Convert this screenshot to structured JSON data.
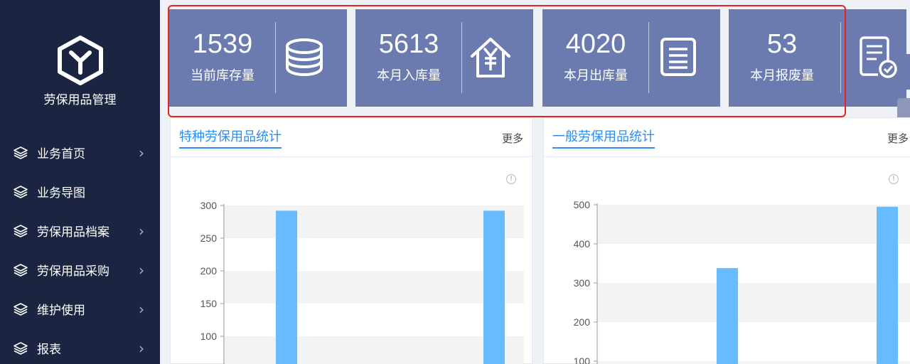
{
  "app": {
    "title": "劳保用品管理"
  },
  "sidebar": {
    "items": [
      {
        "label": "业务首页",
        "icon": "layers-icon",
        "has_children": true
      },
      {
        "label": "业务导图",
        "icon": "layers-icon",
        "has_children": false
      },
      {
        "label": "劳保用品档案",
        "icon": "layers-icon",
        "has_children": true
      },
      {
        "label": "劳保用品采购",
        "icon": "layers-icon",
        "has_children": true
      },
      {
        "label": "维护使用",
        "icon": "layers-icon",
        "has_children": true
      },
      {
        "label": "报表",
        "icon": "layers-icon",
        "has_children": true
      }
    ]
  },
  "stats": [
    {
      "value": "1539",
      "label": "当前库存量",
      "icon": "database-icon"
    },
    {
      "value": "5613",
      "label": "本月入库量",
      "icon": "home-yen-icon"
    },
    {
      "value": "4020",
      "label": "本月出库量",
      "icon": "list-icon"
    },
    {
      "value": "53",
      "label": "本月报废量",
      "icon": "certificate-icon"
    }
  ],
  "panels": [
    {
      "title": "特种劳保用品统计",
      "more": "更多"
    },
    {
      "title": "一般劳保用品统计",
      "more": "更多"
    }
  ],
  "colors": {
    "sidebar_bg": "#1b2440",
    "card_bg": "#6b7bb0",
    "accent": "#2d8cf0",
    "bar": "#67bbff",
    "highlight": "#e52421"
  },
  "chart_data": [
    {
      "type": "bar",
      "ylim": [
        100,
        300
      ],
      "yticks": [
        "300",
        "250",
        "200",
        "150",
        "100"
      ],
      "series": [
        {
          "values": [
            292,
            292
          ]
        }
      ]
    },
    {
      "type": "bar",
      "ylim": [
        100,
        500
      ],
      "yticks": [
        "500",
        "400",
        "300",
        "200",
        "100"
      ],
      "series": [
        {
          "values": [
            338,
            495
          ]
        }
      ]
    }
  ]
}
